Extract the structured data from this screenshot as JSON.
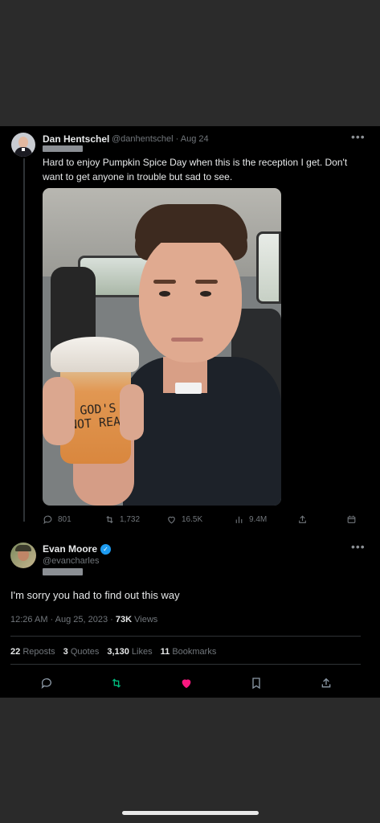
{
  "quoted_tweet": {
    "author_name": "Dan Hentschel",
    "handle_and_date": "@danhentschel · Aug 24",
    "text": "Hard to enjoy Pumpkin Spice Day when this is the reception I get. Don't want to get anyone in trouble but sad to see.",
    "cup_writing": "GOD'S NOT REAL",
    "stats": {
      "replies": "801",
      "reposts": "1,732",
      "likes": "16.5K",
      "views": "9.4M"
    }
  },
  "main_tweet": {
    "author_name": "Evan Moore",
    "handle": "@evancharles",
    "text": "I'm sorry you had to find out this way",
    "timestamp": "12:26 AM · Aug 25, 2023 · ",
    "views_count": "73K",
    "views_label": " Views",
    "counts": {
      "reposts_num": "22",
      "reposts_label": "Reposts",
      "quotes_num": "3",
      "quotes_label": "Quotes",
      "likes_num": "3,130",
      "likes_label": "Likes",
      "bookmarks_num": "11",
      "bookmarks_label": "Bookmarks"
    }
  },
  "icons": {
    "more": "more-dots-icon",
    "reply": "reply-bubble-icon",
    "repost": "repost-arrows-icon",
    "like": "heart-icon",
    "views": "bar-chart-icon",
    "share": "share-upload-icon",
    "bookmark": "bookmark-icon",
    "verified": "verified-badge-icon"
  },
  "colors": {
    "background": "#000000",
    "text_primary": "#e7e9ea",
    "text_secondary": "#71767b",
    "like_active": "#f91880",
    "verified": "#1d9bf0"
  }
}
